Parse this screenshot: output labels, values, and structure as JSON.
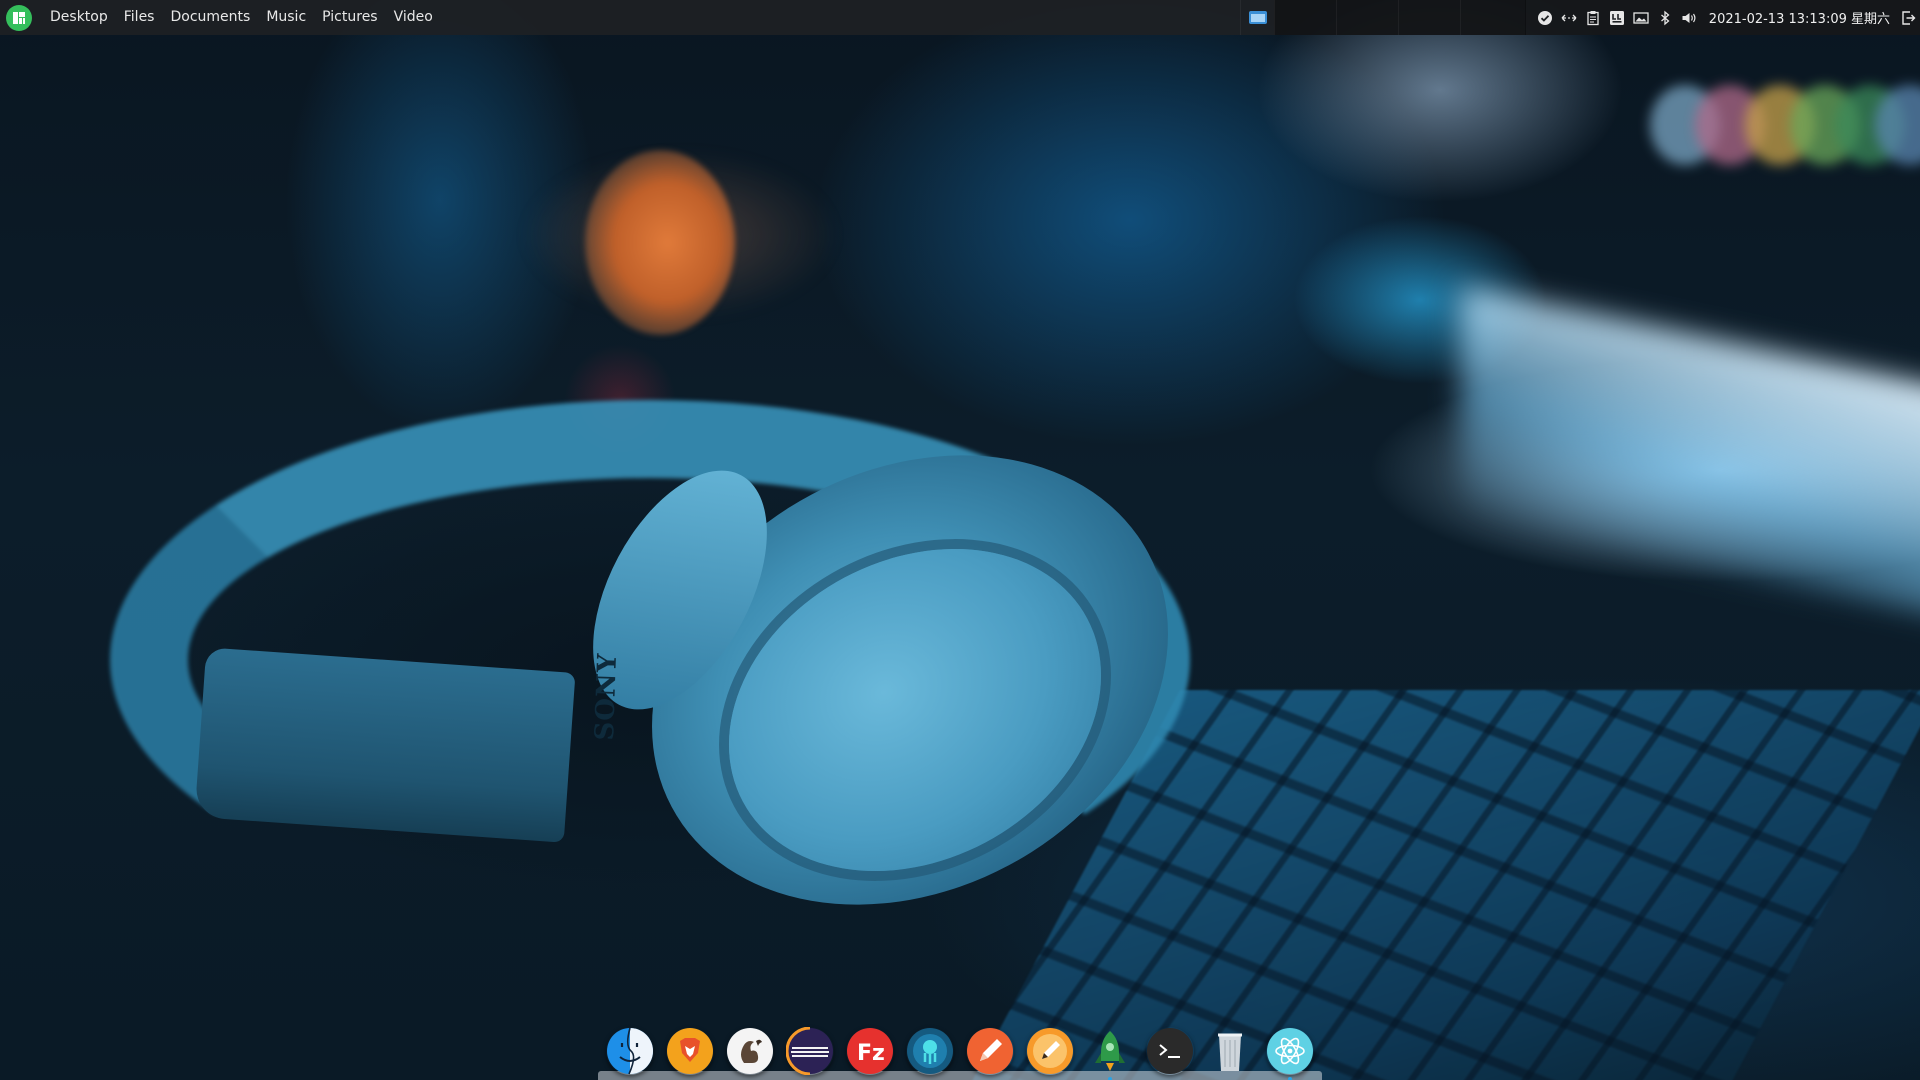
{
  "top_panel": {
    "app_menu_icon": "manjaro-logo-icon",
    "places": [
      {
        "label": "Desktop"
      },
      {
        "label": "Files"
      },
      {
        "label": "Documents"
      },
      {
        "label": "Music"
      },
      {
        "label": "Pictures"
      },
      {
        "label": "Video"
      }
    ],
    "tray": {
      "icons": [
        "checkmark-circle-icon",
        "network-arrows-icon",
        "clipboard-icon",
        "keyboard-layout-icon",
        "display-icon",
        "bluetooth-icon",
        "volume-icon"
      ],
      "clock": "2021-02-13 13:13:09 星期六",
      "logout_icon": "logout-icon"
    }
  },
  "wallpaper": {
    "brand_text": "SONY"
  },
  "dock": {
    "items": [
      {
        "name": "finder-icon",
        "color": "#1e8fe8"
      },
      {
        "name": "brave-browser-icon",
        "color": "#f3a21c"
      },
      {
        "name": "sequel-squirrel-icon",
        "color": "#f4f4f4"
      },
      {
        "name": "eclipse-ide-icon",
        "color": "#2c2255"
      },
      {
        "name": "filezilla-icon",
        "color": "#e6312e"
      },
      {
        "name": "gitkraken-icon",
        "color": "#1f6f9a"
      },
      {
        "name": "pencil-editor-icon",
        "color": "#f06332"
      },
      {
        "name": "sketch-pen-icon",
        "color": "#f79a2a"
      },
      {
        "name": "rocket-launcher-icon",
        "color": "#2e9a49"
      },
      {
        "name": "terminal-icon",
        "color": "#2a2a2a"
      },
      {
        "name": "trash-icon",
        "color": "#cfd6dc"
      },
      {
        "name": "atom-editor-icon",
        "color": "#5fd1e4"
      }
    ]
  }
}
